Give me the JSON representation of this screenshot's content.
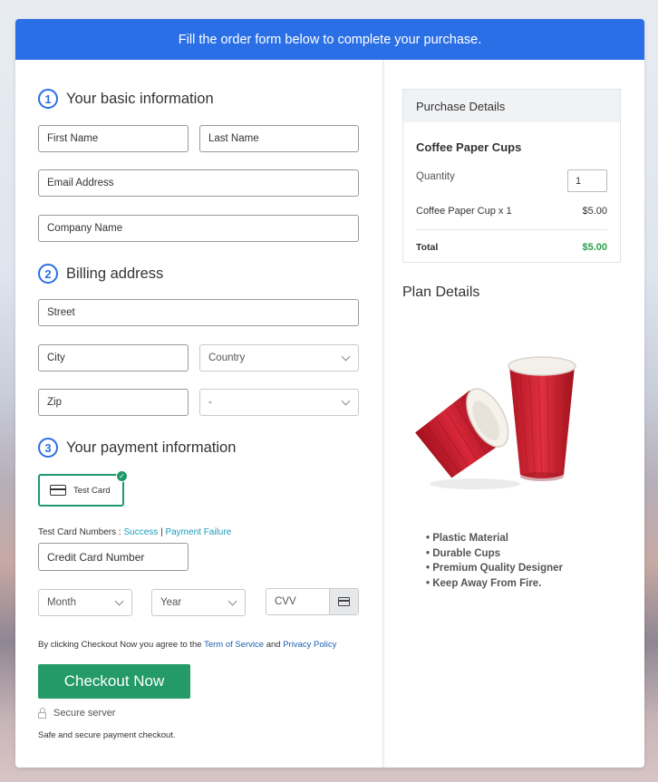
{
  "banner": {
    "text": "Fill the order form below to complete your purchase."
  },
  "sections": {
    "basic": {
      "num": "1",
      "title": "Your basic information"
    },
    "billing": {
      "num": "2",
      "title": "Billing address"
    },
    "payment": {
      "num": "3",
      "title": "Your payment information"
    }
  },
  "fields": {
    "first_name": "First Name",
    "last_name": "Last Name",
    "email": "Email Address",
    "company": "Company Name",
    "street": "Street",
    "city": "City",
    "country": "Country",
    "zip": "Zip",
    "state": "-",
    "card_number": "Credit Card Number",
    "month": "Month",
    "year": "Year",
    "cvv": "CVV"
  },
  "payment": {
    "test_card_label": "Test Card",
    "test_numbers_prefix": "Test Card Numbers :",
    "success_link": "Success",
    "separator": "|",
    "failure_link": "Payment Failure"
  },
  "terms": {
    "prefix": "By clicking Checkout Now you agree to the",
    "tos_link": "Term of Service",
    "and": "and",
    "privacy_link": "Privacy Policy"
  },
  "checkout": {
    "button_label": "Checkout Now",
    "secure_label": "Secure server",
    "note": "Safe and secure payment checkout."
  },
  "purchase": {
    "header": "Purchase Details",
    "product": "Coffee Paper Cups",
    "quantity_label": "Quantity",
    "quantity_value": "1",
    "line_item": "Coffee Paper Cup x 1",
    "line_price": "$5.00",
    "total_label": "Total",
    "total_value": "$5.00"
  },
  "plan": {
    "title": "Plan Details",
    "features": [
      "Plastic Material",
      "Durable Cups",
      "Premium Quality Designer",
      "Keep Away From Fire."
    ]
  },
  "colors": {
    "banner": "#2a6fe6",
    "checkout": "#239a67",
    "total": "#2aa04a",
    "link": "#1b9bb8"
  }
}
